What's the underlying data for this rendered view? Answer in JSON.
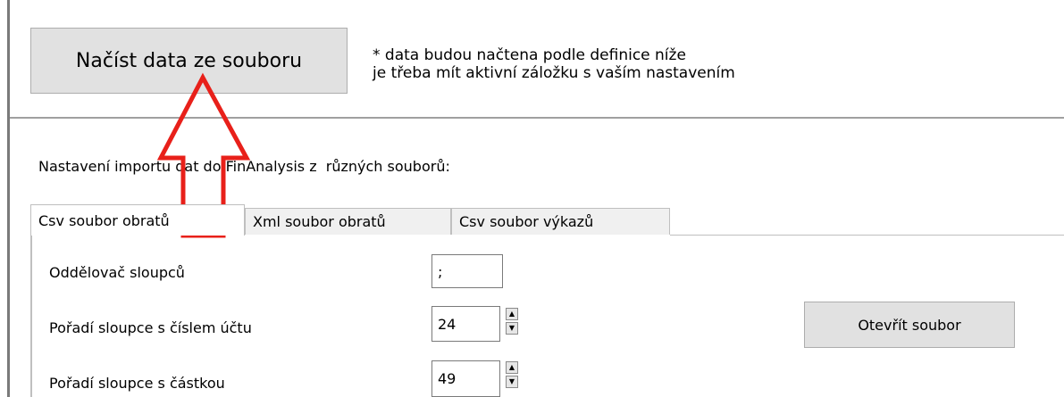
{
  "load_button": {
    "label": "Načíst data ze souboru"
  },
  "note": {
    "line1": "* data budou načtena podle definice níže",
    "line2": "je třeba mít aktivní záložku s vaším nastavením"
  },
  "settings_title": "Nastavení importu dat do FinAnalysis z  různých souborů:",
  "tabs": [
    {
      "label": "Csv soubor obratů",
      "active": true
    },
    {
      "label": "Xml soubor obratů",
      "active": false
    },
    {
      "label": "Csv soubor výkazů",
      "active": false
    }
  ],
  "fields": {
    "separator": {
      "label": "Oddělovač sloupců",
      "value": ";"
    },
    "account_col": {
      "label": "Pořadí sloupce s číslem účtu",
      "value": "24"
    },
    "amount_col": {
      "label": "Pořadí sloupce s částkou",
      "value": "49"
    }
  },
  "open_button": {
    "label": "Otevřít soubor"
  },
  "annotation": {
    "icon": "red-outline-arrow-up-icon",
    "color": "#e8201a"
  }
}
